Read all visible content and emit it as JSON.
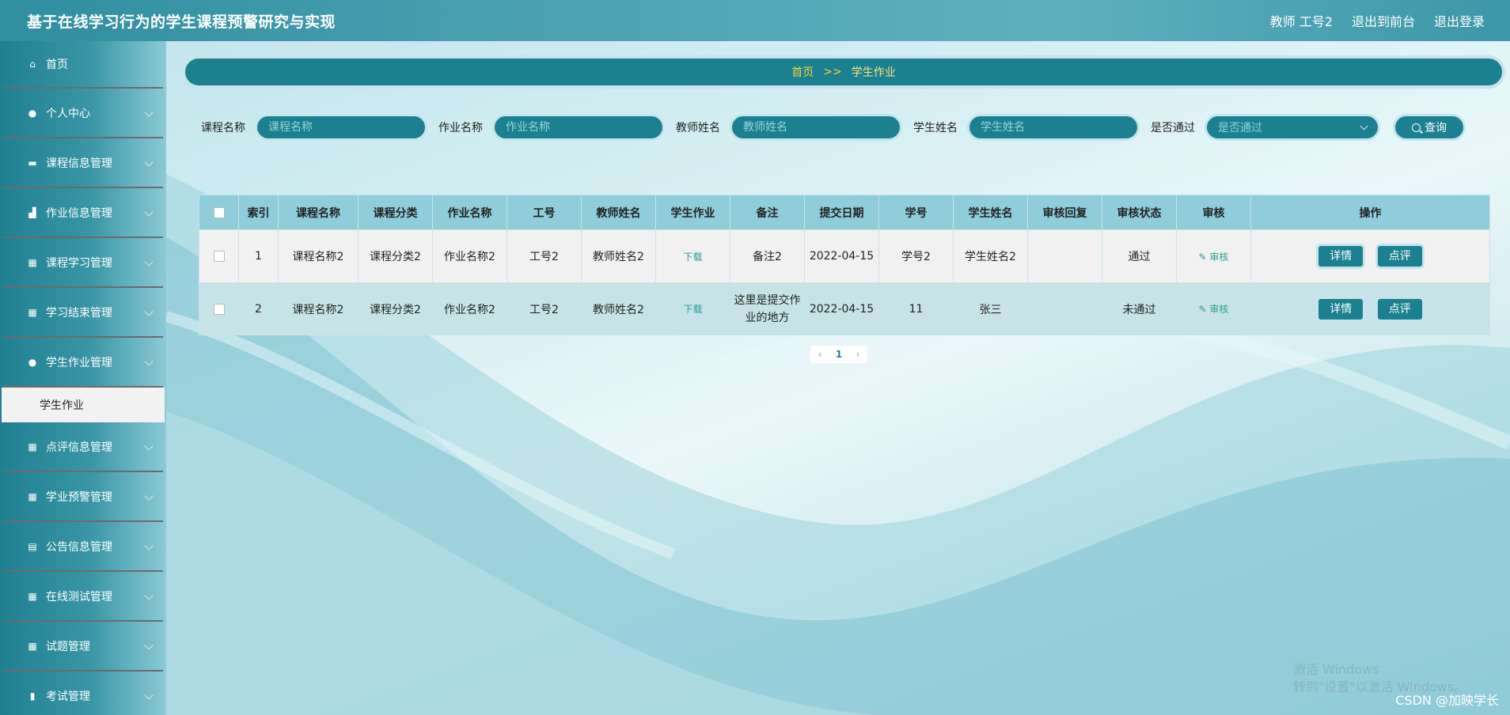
{
  "header": {
    "title": "基于在线学习行为的学生课程预警研究与实现",
    "user": "教师 工号2",
    "to_front": "退出到前台",
    "logout": "退出登录"
  },
  "sidebar": {
    "items": [
      {
        "label": "首页",
        "icon": "home-icon"
      },
      {
        "label": "个人中心",
        "icon": "user-icon"
      },
      {
        "label": "课程信息管理",
        "icon": "book-icon"
      },
      {
        "label": "作业信息管理",
        "icon": "chart-icon"
      },
      {
        "label": "课程学习管理",
        "icon": "grid-icon"
      },
      {
        "label": "学习结束管理",
        "icon": "grid-icon"
      },
      {
        "label": "学生作业管理",
        "icon": "user-icon"
      },
      {
        "label": "点评信息管理",
        "icon": "grid-icon"
      },
      {
        "label": "学业预警管理",
        "icon": "grid-icon"
      },
      {
        "label": "公告信息管理",
        "icon": "clipboard-icon"
      },
      {
        "label": "在线测试管理",
        "icon": "grid-icon"
      },
      {
        "label": "试题管理",
        "icon": "grid-icon"
      },
      {
        "label": "考试管理",
        "icon": "bar-chart-icon"
      }
    ],
    "active_sub": "学生作业"
  },
  "breadcrumb": {
    "home": "首页",
    "sep": ">>",
    "current": "学生作业"
  },
  "search": {
    "course_label": "课程名称",
    "course_placeholder": "课程名称",
    "homework_label": "作业名称",
    "homework_placeholder": "作业名称",
    "teacher_label": "教师姓名",
    "teacher_placeholder": "教师姓名",
    "student_label": "学生姓名",
    "student_placeholder": "学生姓名",
    "passed_label": "是否通过",
    "passed_placeholder": "是否通过",
    "query": "查询"
  },
  "table": {
    "headers": [
      "索引",
      "课程名称",
      "课程分类",
      "作业名称",
      "工号",
      "教师姓名",
      "学生作业",
      "备注",
      "提交日期",
      "学号",
      "学生姓名",
      "审核回复",
      "审核状态",
      "审核",
      "操作"
    ],
    "rows": [
      {
        "idx": "1",
        "course": "课程名称2",
        "cat": "课程分类2",
        "hw": "作业名称2",
        "tid": "工号2",
        "tname": "教师姓名2",
        "file": "下载",
        "note": "备注2",
        "date": "2022-04-15",
        "sid": "学号2",
        "sname": "学生姓名2",
        "reply": "",
        "status": "通过",
        "audit": "审核",
        "detail": "详情",
        "comment": "点评"
      },
      {
        "idx": "2",
        "course": "课程名称2",
        "cat": "课程分类2",
        "hw": "作业名称2",
        "tid": "工号2",
        "tname": "教师姓名2",
        "file": "下载",
        "note": "这里是提交作业的地方",
        "date": "2022-04-15",
        "sid": "11",
        "sname": "张三",
        "reply": "",
        "status": "未通过",
        "audit": "审核",
        "detail": "详情",
        "comment": "点评"
      }
    ]
  },
  "pagination": {
    "current": "1"
  },
  "watermark": {
    "line1": "激活 Windows",
    "line2": "转到\"设置\"以激活 Windows。"
  },
  "credit": "CSDN @加映学长"
}
